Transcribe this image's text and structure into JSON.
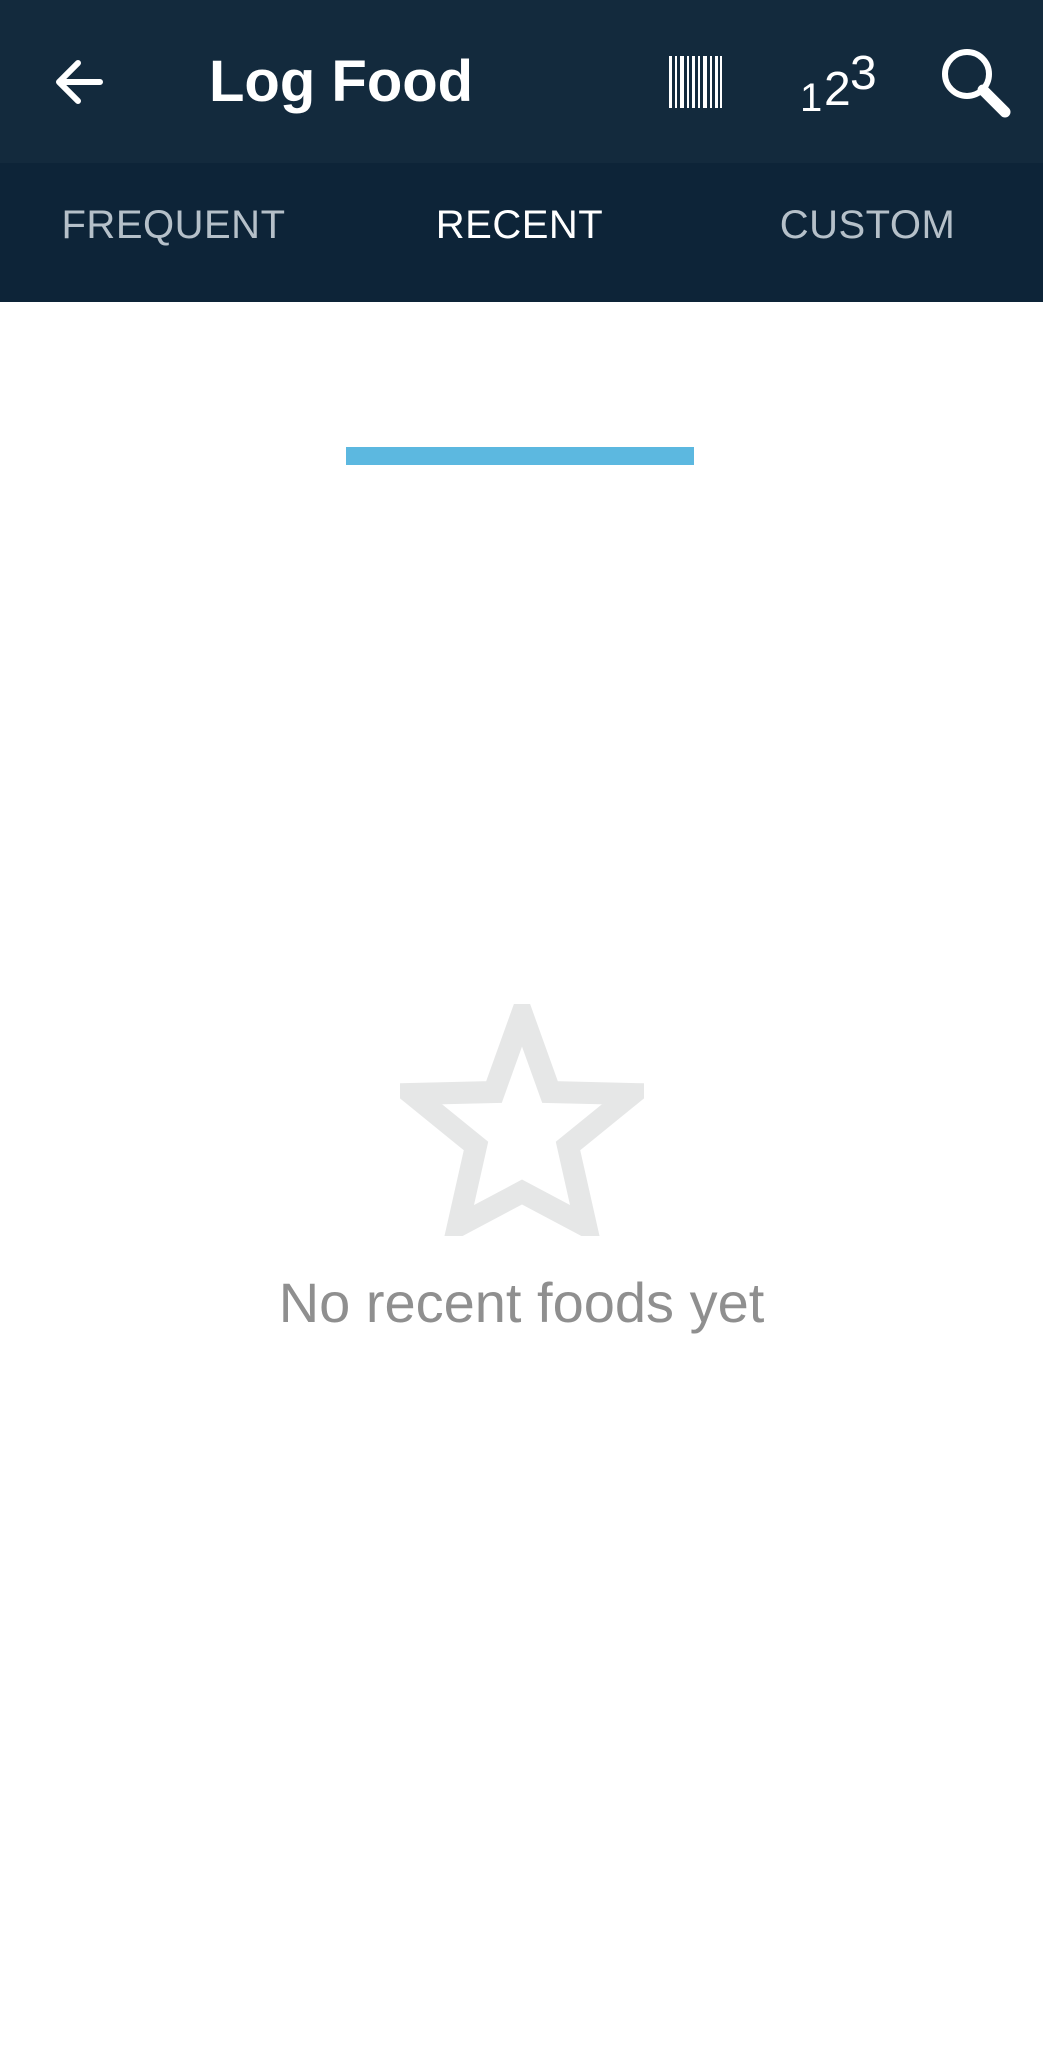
{
  "app_bar": {
    "title": "Log Food",
    "back_icon": "arrow-back-icon",
    "actions": [
      {
        "name": "barcode",
        "icon": "barcode-icon"
      },
      {
        "name": "quick-calories",
        "icon": "numeric-icon",
        "label": "123"
      },
      {
        "name": "search",
        "icon": "search-icon"
      }
    ]
  },
  "tabs": [
    {
      "label": "FREQUENT",
      "active": false
    },
    {
      "label": "RECENT",
      "active": true
    },
    {
      "label": "CUSTOM",
      "active": false
    }
  ],
  "empty_state": {
    "icon": "star-outline-icon",
    "message": "No recent foods yet"
  },
  "colors": {
    "app_bar": "#132a3d",
    "tab_bar": "#0d2438",
    "tab_indicator": "#5cb8e0",
    "inactive_tab_text": "#b5c0c9",
    "empty_icon": "#e6e7e7",
    "empty_text": "#8f8f8f"
  }
}
